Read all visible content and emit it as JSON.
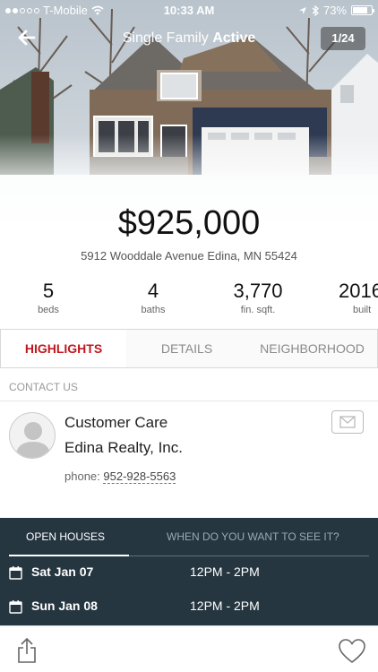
{
  "status_bar": {
    "carrier": "T-Mobile",
    "time": "10:33 AM",
    "battery": "73%"
  },
  "nav": {
    "title_prefix": "Single Family",
    "title_status": "Active",
    "photo_counter": "1/24"
  },
  "listing": {
    "price": "$925,000",
    "address": "5912 Wooddale Avenue Edina, MN 55424"
  },
  "stats": [
    {
      "value": "5",
      "label": "beds"
    },
    {
      "value": "4",
      "label": "baths"
    },
    {
      "value": "3,770",
      "label": "fin. sqft."
    },
    {
      "value": "2016",
      "label": "built"
    }
  ],
  "tabs": [
    {
      "label": "HIGHLIGHTS",
      "active": true
    },
    {
      "label": "DETAILS",
      "active": false
    },
    {
      "label": "NEIGHBORHOOD",
      "active": false
    }
  ],
  "contact": {
    "section_label": "CONTACT US",
    "name": "Customer Care",
    "company": "Edina Realty, Inc.",
    "phone_label": "phone:",
    "phone": "952-928-5563"
  },
  "open_houses": {
    "tab_active": "OPEN HOUSES",
    "tab_inactive": "WHEN DO YOU WANT TO SEE IT?",
    "items": [
      {
        "date": "Sat Jan 07",
        "time": "12PM - 2PM"
      },
      {
        "date": "Sun Jan 08",
        "time": "12PM - 2PM"
      }
    ]
  },
  "colors": {
    "accent": "#c0181e",
    "open_house_bg": "#263641"
  },
  "icons": [
    "back-arrow-icon",
    "wifi-icon",
    "location-icon",
    "bluetooth-icon",
    "mail-icon",
    "calendar-icon",
    "share-icon",
    "heart-icon",
    "avatar-icon"
  ]
}
